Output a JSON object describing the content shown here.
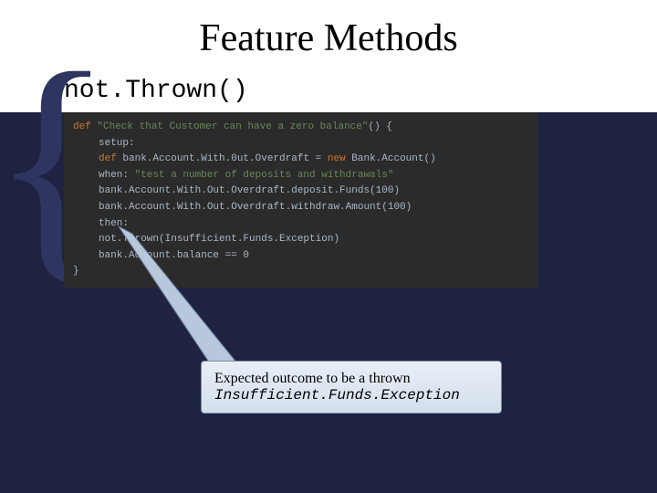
{
  "title": "Feature Methods",
  "subtitle": "not.Thrown()",
  "code": {
    "l1_kw": "def",
    "l1_str": "\"Check that Customer can have a zero balance\"",
    "l1_tail": "() {",
    "l2": "setup:",
    "l3_kw": "def",
    "l3_rest": " bank.Account.With.0ut.Overdraft = ",
    "l3_new": "new",
    "l3_tail": " Bank.Account()",
    "l4_when": "when: ",
    "l4_str": "\"test a number of deposits and withdrawals\"",
    "l5": "bank.Account.With.Out.Overdraft.deposit.Funds(100)",
    "l6": "bank.Account.With.Out.Overdraft.withdraw.Amount(100)",
    "l7": "then:",
    "l8": "not.Thrown(Insufficient.Funds.Exception)",
    "l9": "bank.Account.balance == 0",
    "l10": "}"
  },
  "callout": {
    "line1": "Expected outcome to be a thrown",
    "line2": "Insufficient.Funds.Exception"
  }
}
